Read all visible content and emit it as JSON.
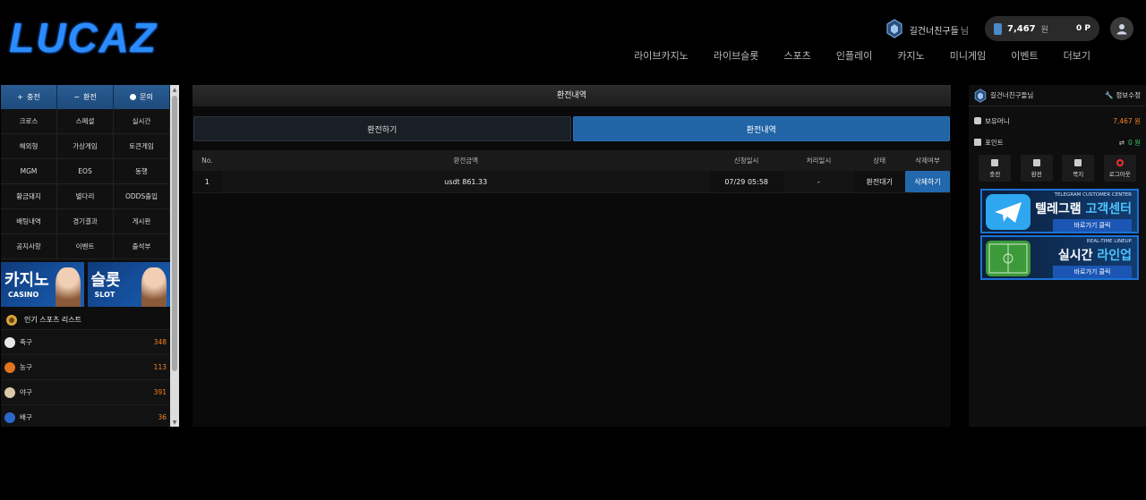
{
  "header": {
    "logo": "LUCAZ",
    "user_name": "길건너친구들",
    "user_suffix": "님",
    "money": "7,467",
    "money_unit": "원",
    "points": "0 P",
    "nav": [
      "라이브카지노",
      "라이브슬롯",
      "스포츠",
      "인플레이",
      "카지노",
      "미니게임",
      "이벤트",
      "더보기"
    ]
  },
  "left": {
    "top_buttons": [
      {
        "label": "충전",
        "icon": "plus-icon"
      },
      {
        "label": "환전",
        "icon": "minus-icon"
      },
      {
        "label": "문의",
        "icon": "circle-icon"
      }
    ],
    "menu": [
      "크로스",
      "스페셜",
      "실시간",
      "해외형",
      "가상게임",
      "토큰게임",
      "MGM",
      "EOS",
      "동행",
      "황금돼지",
      "별다리",
      "ODDS출입",
      "배팅내역",
      "경기결과",
      "게시판",
      "공지사항",
      "이벤트",
      "출석부"
    ],
    "banners": [
      {
        "big": "카지노",
        "small": "CASINO"
      },
      {
        "big": "슬롯",
        "small": "SLOT"
      }
    ],
    "section_title": "인기 스포츠 리스트",
    "sports": [
      {
        "name": "축구",
        "count": "348",
        "color": "#e8e8e8"
      },
      {
        "name": "농구",
        "count": "113",
        "color": "#e0741f"
      },
      {
        "name": "야구",
        "count": "391",
        "color": "#d9c9a8"
      },
      {
        "name": "배구",
        "count": "36",
        "color": "#2b67c9"
      }
    ]
  },
  "main": {
    "title": "환전내역",
    "tabs": [
      "환전하기",
      "환전내역"
    ],
    "active_tab": 1,
    "columns": [
      "No.",
      "환전금액",
      "신청일시",
      "처리일시",
      "상태",
      "삭제여부"
    ],
    "rows": [
      {
        "no": "1",
        "amount": "usdt 861.33",
        "requested": "07/29 05:58",
        "processed": "-",
        "status": "환전대기",
        "action": "삭제하기"
      }
    ]
  },
  "right": {
    "user_name": "길건너친구들님",
    "edit_label": "정보수정",
    "money_label": "보유머니",
    "money_value": "7,467 원",
    "point_label": "포인트",
    "point_value": "0 원",
    "actions": [
      "충전",
      "환전",
      "쪽지",
      "로그아웃"
    ],
    "promos": [
      {
        "caption": "TELEGRAM CUSTOMER CENTER",
        "head1": "텔레그램 ",
        "head2": "고객센터",
        "button": "바로가기 클릭"
      },
      {
        "caption": "REAL-TIME LINEUP",
        "head1": "실시간 ",
        "head2": "라인업",
        "button": "바로가기 클릭"
      }
    ]
  },
  "colors": {
    "accent": "#2265a6",
    "orange": "#f58220",
    "green": "#3ec26a"
  }
}
